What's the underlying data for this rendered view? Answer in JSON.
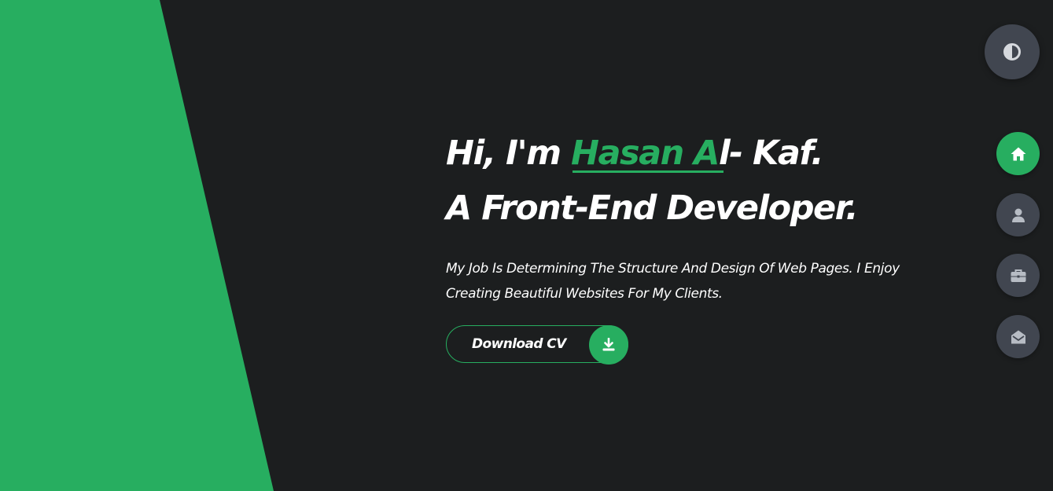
{
  "colors": {
    "accent": "#27ae60",
    "background": "#1c1e1f",
    "nav_button": "#414650",
    "text": "#ffffff"
  },
  "hero": {
    "greeting_prefix": "Hi, I'm ",
    "name_highlight": "Hasan A",
    "name_rest": "l- Kaf.",
    "role_line": "A Front-End Developer.",
    "intro": "My Job Is Determining The Structure And Design Of Web Pages. I Enjoy Creating Beautiful Websites For My Clients.",
    "cv_button_label": "Download CV",
    "cv_button_icon": "download-icon"
  },
  "controls": {
    "theme_toggle_icon": "half-circle-contrast-icon"
  },
  "nav": {
    "items": [
      {
        "id": "home",
        "icon": "home-icon",
        "active": true
      },
      {
        "id": "about",
        "icon": "user-icon",
        "active": false
      },
      {
        "id": "portfolio",
        "icon": "briefcase-icon",
        "active": false
      },
      {
        "id": "contact",
        "icon": "envelope-open-icon",
        "active": false
      }
    ]
  }
}
